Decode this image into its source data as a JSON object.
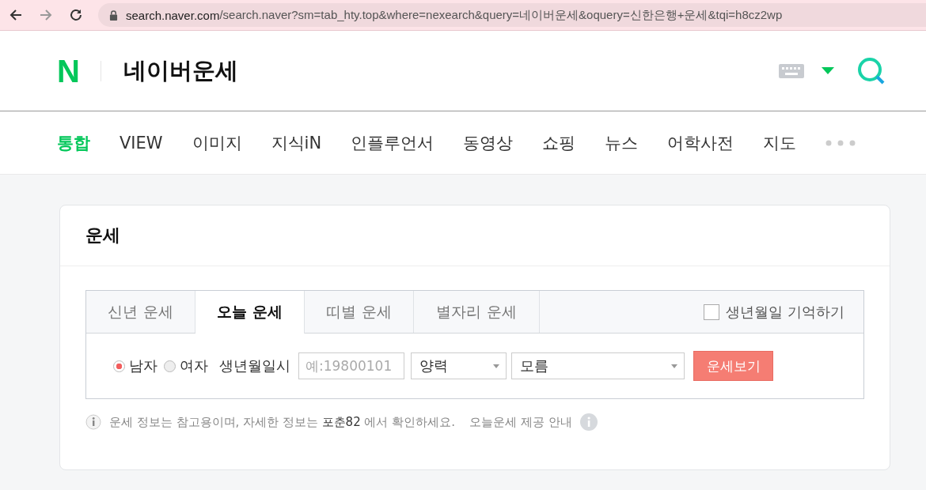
{
  "browser": {
    "url_host": "search.naver.com",
    "url_path": "/search.naver?sm=tab_hty.top&where=nexearch&query=네이버운세&oquery=신한은행+운세&tqi=h8cz2wp"
  },
  "header": {
    "logo": "N",
    "title": "네이버운세"
  },
  "nav": [
    {
      "label": "통합",
      "selected": true
    },
    {
      "label": "VIEW",
      "selected": false
    },
    {
      "label": "이미지",
      "selected": false
    },
    {
      "label": "지식iN",
      "selected": false
    },
    {
      "label": "인플루언서",
      "selected": false
    },
    {
      "label": "동영상",
      "selected": false
    },
    {
      "label": "쇼핑",
      "selected": false
    },
    {
      "label": "뉴스",
      "selected": false
    },
    {
      "label": "어학사전",
      "selected": false
    },
    {
      "label": "지도",
      "selected": false
    }
  ],
  "card": {
    "title": "운세",
    "tabs": [
      {
        "label": "신년 운세",
        "selected": false
      },
      {
        "label": "오늘 운세",
        "selected": true
      },
      {
        "label": "띠별 운세",
        "selected": false
      },
      {
        "label": "별자리 운세",
        "selected": false
      }
    ],
    "remember": {
      "label": "생년월일 기억하기",
      "checked": false
    },
    "genders": [
      {
        "label": "남자",
        "selected": true
      },
      {
        "label": "여자",
        "selected": false
      }
    ],
    "birth_label": "생년월일시",
    "birth_placeholder": "예:19800101",
    "calendar": "양력",
    "time": "모름",
    "submit": "운세보기",
    "notice_before": "운세 정보는 참고용이며, 자세한 정보는",
    "notice_link": "포춘82",
    "notice_after": "에서 확인하세요.",
    "guide": "오늘운세 제공 안내"
  }
}
